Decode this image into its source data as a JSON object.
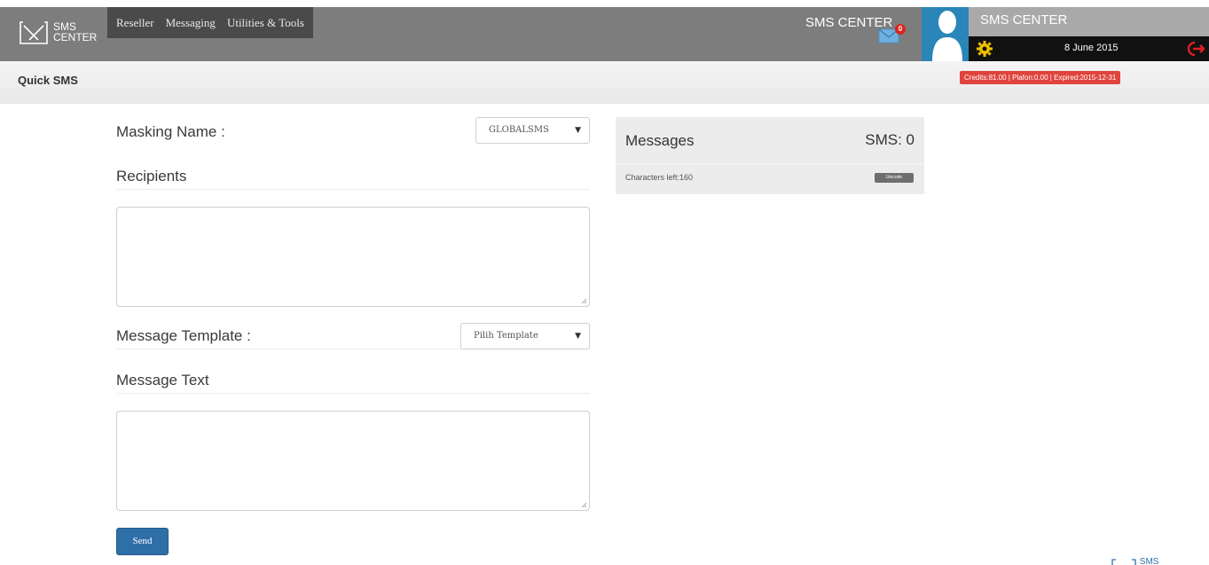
{
  "app": {
    "logo_line1": "SMS",
    "logo_line2": "CENTER"
  },
  "nav": {
    "items": [
      {
        "label": "Reseller"
      },
      {
        "label": "Messaging"
      },
      {
        "label": "Utilities & Tools"
      }
    ]
  },
  "header": {
    "center_title": "SMS CENTER",
    "mail_badge": "0",
    "profile_name": "SMS CENTER",
    "date": "8 June 2015"
  },
  "page": {
    "title": "Quick SMS",
    "credits": "Credits:81.00 | Plafon:0.00 | Expired:2015-12-31"
  },
  "form": {
    "masking_label": "Masking Name :",
    "masking_value": "GLOBALSMS",
    "recipients_label": "Recipients",
    "recipients_value": "",
    "template_label": "Message Template :",
    "template_value": "Pilih Template",
    "message_label": "Message Text",
    "message_value": "",
    "send_label": "Send"
  },
  "messages_panel": {
    "title": "Messages",
    "sms_count": "SMS: 0",
    "chars_left": "Characters left:160",
    "encoding_badge": "Unicode"
  },
  "footer": {
    "logo_text": "SMS"
  },
  "colors": {
    "topbar": "#7d7d7d",
    "nav_bg": "#4a4a4a",
    "avatar_bg": "#2a86b9",
    "credits_bg": "#e0433c",
    "send_button": "#2f6fa8"
  }
}
